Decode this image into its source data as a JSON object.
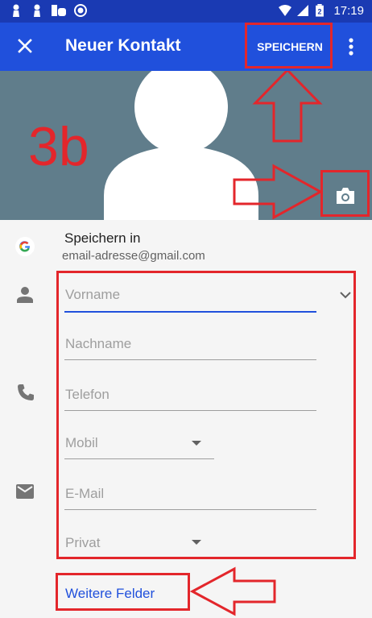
{
  "statusbar": {
    "time": "17:19",
    "battery_level": "2"
  },
  "appbar": {
    "title": "Neuer Kontakt",
    "save_label": "SPEICHERN"
  },
  "annotation": {
    "step_label": "3b"
  },
  "account": {
    "label": "Speichern in",
    "email": "email-adresse@gmail.com"
  },
  "fields": {
    "first_name_placeholder": "Vorname",
    "last_name_placeholder": "Nachname",
    "phone_placeholder": "Telefon",
    "phone_type": "Mobil",
    "email_placeholder": "E-Mail",
    "email_type": "Privat"
  },
  "more_fields_label": "Weitere Felder",
  "colors": {
    "statusbar": "#1a3ab3",
    "appbar": "#2050dc",
    "photo_bg": "#607d8b",
    "accent": "#2050dc",
    "annotation": "#e3262b"
  }
}
